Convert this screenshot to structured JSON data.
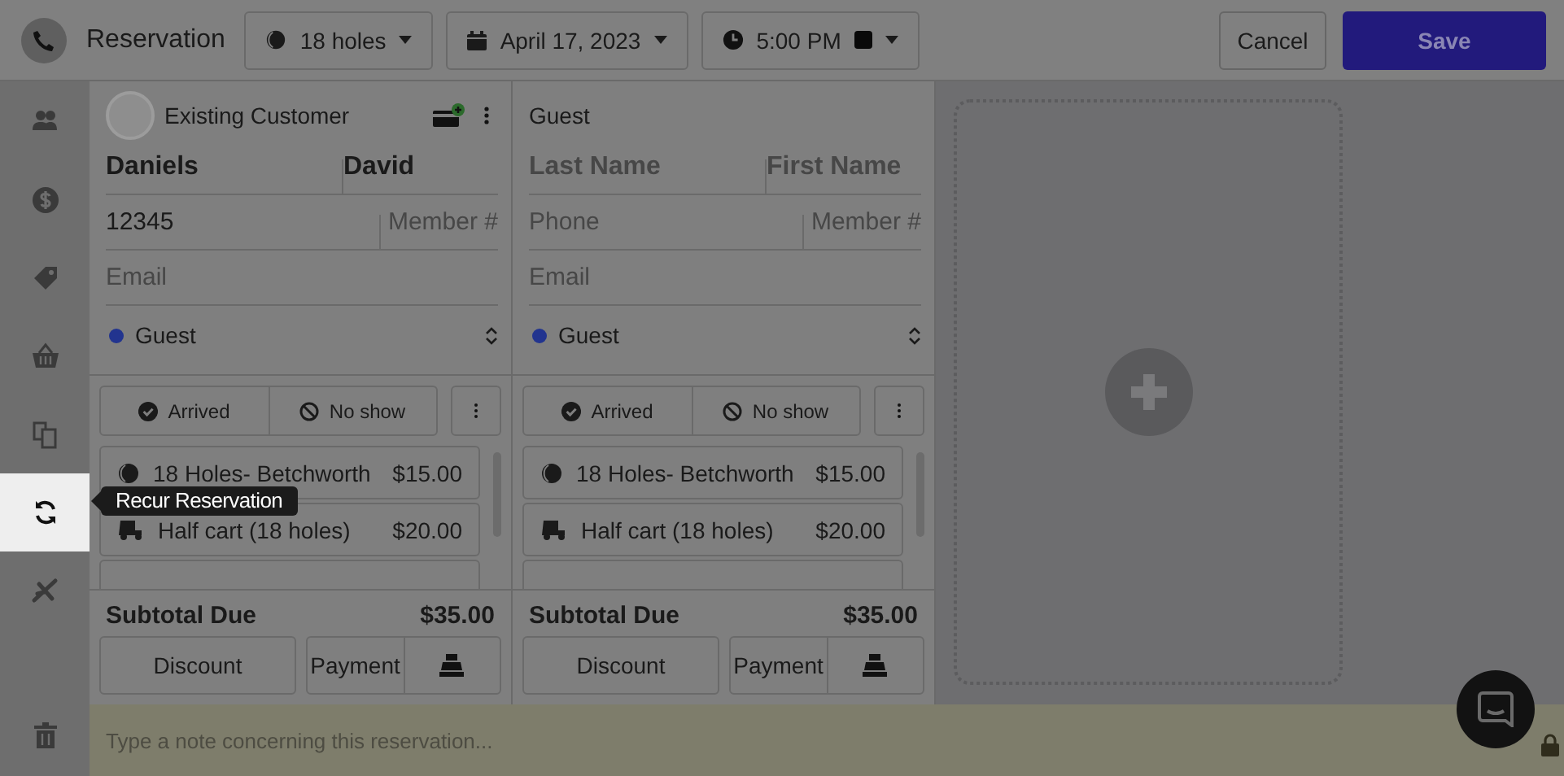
{
  "header": {
    "title": "Reservation",
    "holes_select": "18 holes",
    "date_select": "April 17, 2023",
    "time_select": "5:00 PM",
    "cancel": "Cancel",
    "save": "Save"
  },
  "sidebar": {
    "items": [
      {
        "selected": false
      },
      {
        "selected": false
      },
      {
        "selected": false
      },
      {
        "selected": false
      },
      {
        "selected": false
      },
      {
        "selected": true
      },
      {
        "selected": false
      }
    ],
    "tooltip": "Recur Reservation"
  },
  "players": [
    {
      "kind": "existing",
      "label": "Existing Customer",
      "last_name": {
        "value": "Daniels"
      },
      "first_name": {
        "value": "David"
      },
      "phone": {
        "value": "12345"
      },
      "member": {
        "placeholder": "Member #"
      },
      "email": {
        "placeholder": "Email"
      },
      "customer_type": {
        "label": "Guest",
        "color": "#22348f"
      },
      "arrived": "Arrived",
      "no_show": "No show",
      "line_items": [
        {
          "kind": "green_fee",
          "name": "18 Holes- Betchworth",
          "price": "$15.00"
        },
        {
          "kind": "cart",
          "name": "Half cart (18 holes)",
          "price": "$20.00"
        },
        {
          "kind": "empty"
        }
      ],
      "subtotal_label": "Subtotal Due",
      "subtotal": "$35.00",
      "discount": "Discount",
      "payment": "Payment"
    },
    {
      "kind": "guest",
      "label": "Guest",
      "last_name": {
        "placeholder": "Last Name"
      },
      "first_name": {
        "placeholder": "First Name"
      },
      "phone": {
        "placeholder": "Phone"
      },
      "member": {
        "placeholder": "Member #"
      },
      "email": {
        "placeholder": "Email"
      },
      "customer_type": {
        "label": "Guest",
        "color": "#22348f"
      },
      "arrived": "Arrived",
      "no_show": "No show",
      "line_items": [
        {
          "kind": "green_fee",
          "name": "18 Holes- Betchworth",
          "price": "$15.00"
        },
        {
          "kind": "cart",
          "name": "Half cart (18 holes)",
          "price": "$20.00"
        },
        {
          "kind": "empty"
        }
      ],
      "subtotal_label": "Subtotal Due",
      "subtotal": "$35.00",
      "discount": "Discount",
      "payment": "Payment"
    }
  ],
  "note": {
    "placeholder": "Type a note concerning this reservation..."
  }
}
